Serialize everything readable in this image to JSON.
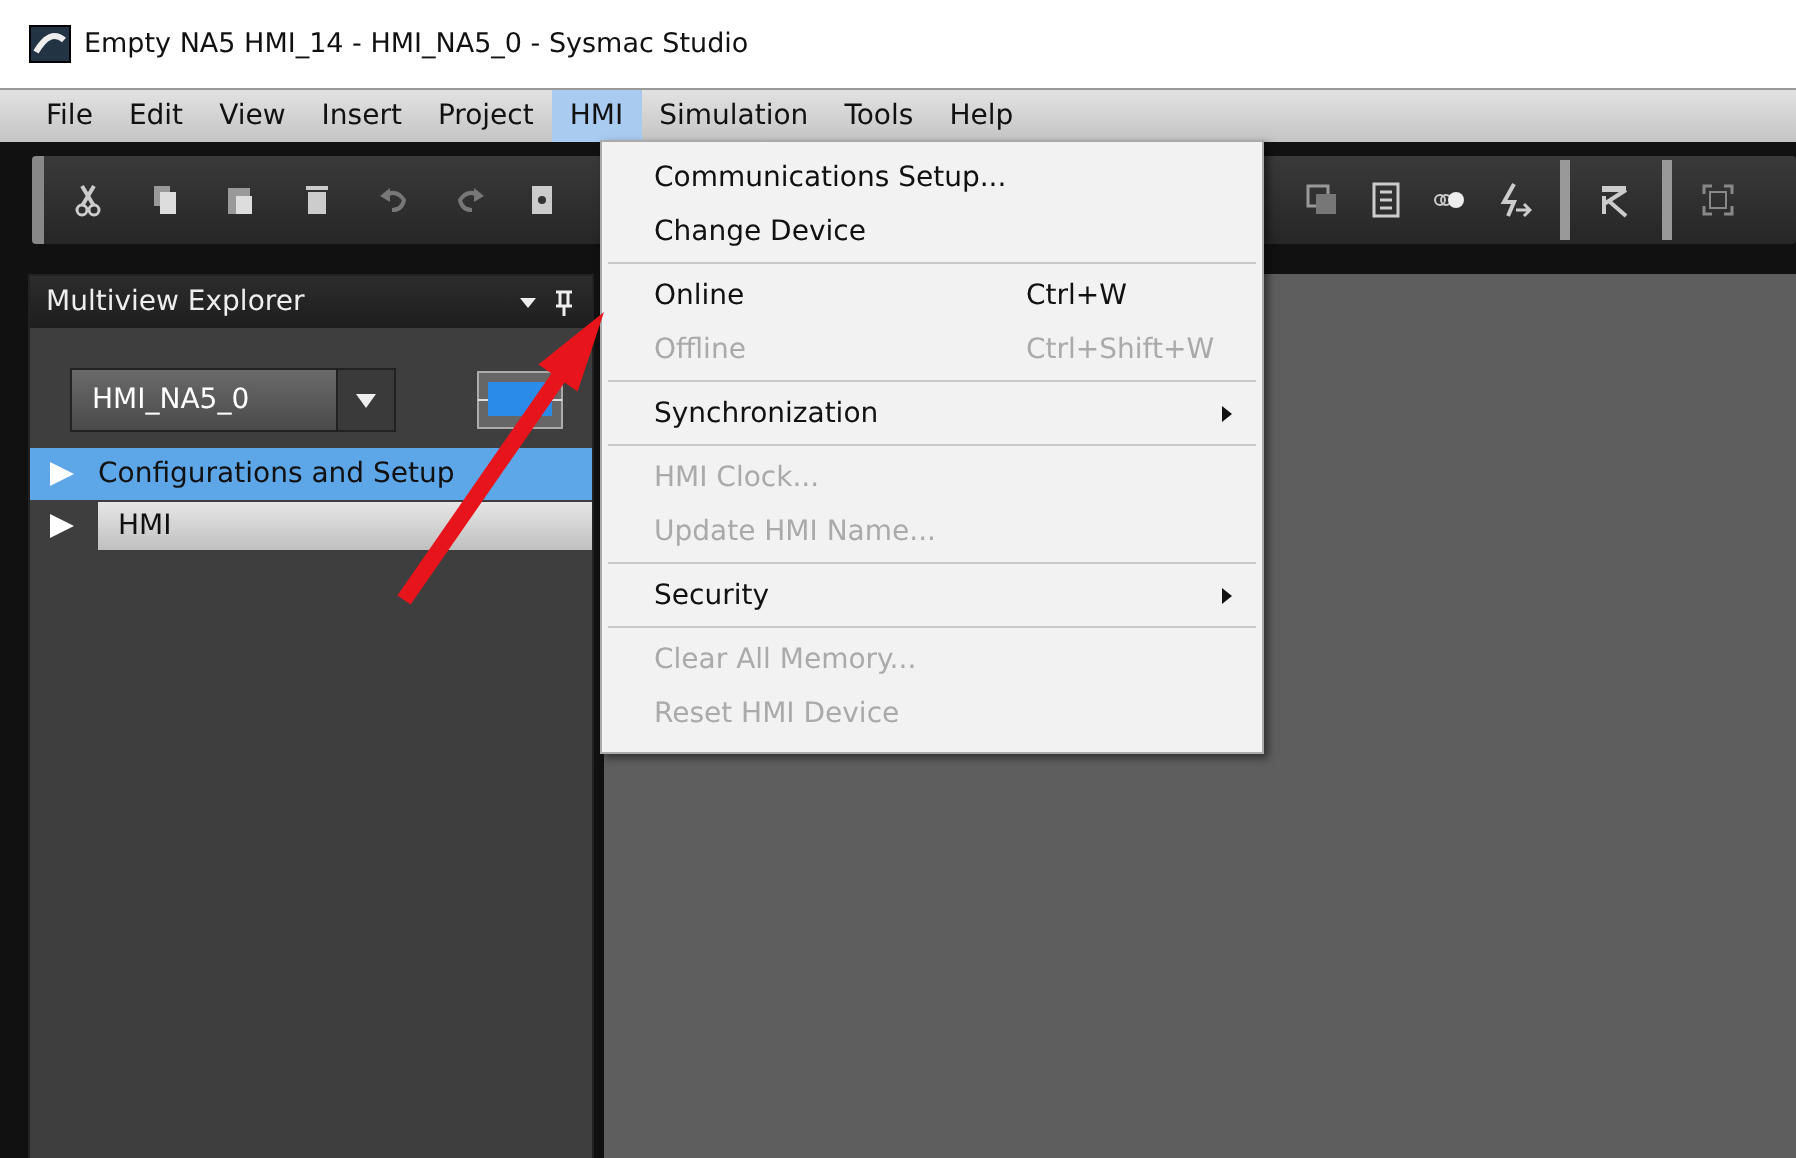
{
  "window": {
    "title": "Empty NA5 HMI_14 - HMI_NA5_0 - Sysmac Studio"
  },
  "menu_bar": [
    {
      "label": "File",
      "selected": false
    },
    {
      "label": "Edit",
      "selected": false
    },
    {
      "label": "View",
      "selected": false
    },
    {
      "label": "Insert",
      "selected": false
    },
    {
      "label": "Project",
      "selected": false
    },
    {
      "label": "HMI",
      "selected": true
    },
    {
      "label": "Simulation",
      "selected": false
    },
    {
      "label": "Tools",
      "selected": false
    },
    {
      "label": "Help",
      "selected": false
    }
  ],
  "explorer": {
    "title": "Multiview Explorer",
    "device": "HMI_NA5_0",
    "items": [
      {
        "label": "Configurations and Setup",
        "selected": true,
        "expanded": false
      },
      {
        "label": "HMI",
        "selected": false,
        "expanded": false
      }
    ]
  },
  "hmi_menu": [
    [
      {
        "label": "Communications Setup...",
        "kind": "item",
        "disabled": false
      },
      {
        "label": "Change Device",
        "kind": "item",
        "disabled": false
      }
    ],
    [
      {
        "label": "Online",
        "kind": "item",
        "shortcut": "Ctrl+W",
        "disabled": false
      },
      {
        "label": "Offline",
        "kind": "item",
        "shortcut": "Ctrl+Shift+W",
        "disabled": true
      }
    ],
    [
      {
        "label": "Synchronization",
        "kind": "submenu",
        "disabled": false
      }
    ],
    [
      {
        "label": "HMI Clock...",
        "kind": "item",
        "disabled": true
      },
      {
        "label": "Update HMI Name...",
        "kind": "item",
        "disabled": true
      }
    ],
    [
      {
        "label": "Security",
        "kind": "submenu",
        "disabled": false
      }
    ],
    [
      {
        "label": "Clear All Memory...",
        "kind": "item",
        "disabled": true
      },
      {
        "label": "Reset HMI Device",
        "kind": "item",
        "disabled": true
      }
    ]
  ]
}
